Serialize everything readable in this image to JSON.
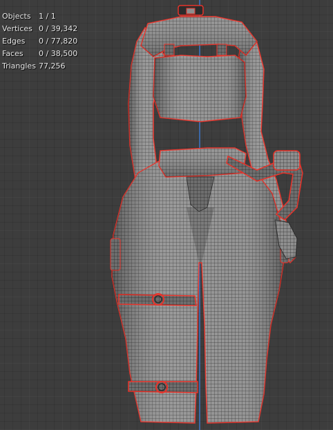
{
  "viewport": {
    "background": "#3d3d3d",
    "grid_color": "#4a4a4a",
    "axis_color": "#3c6fb8",
    "selection_outline_color": "#e8332a",
    "mesh_fill_color": "#8e8e8e",
    "wireframe_color": "#2b2b2b"
  },
  "stats": {
    "objects_label": "Objects",
    "objects_value": "1 / 1",
    "vertices_label": "Vertices",
    "vertices_value": "0 / 39,342",
    "edges_label": "Edges",
    "edges_value": "0 / 77,820",
    "faces_label": "Faces",
    "faces_value": "0 / 38,500",
    "triangles_label": "Triangles",
    "triangles_value": "77,256"
  },
  "model": {
    "icon": "character-mesh-icon",
    "parts": [
      "choker",
      "shrug",
      "crop-top",
      "left-arm",
      "right-arm",
      "waistband",
      "cargo-pants",
      "thigh-strap-upper",
      "thigh-strap-lower",
      "shoulder-bag-strap",
      "hand"
    ]
  }
}
